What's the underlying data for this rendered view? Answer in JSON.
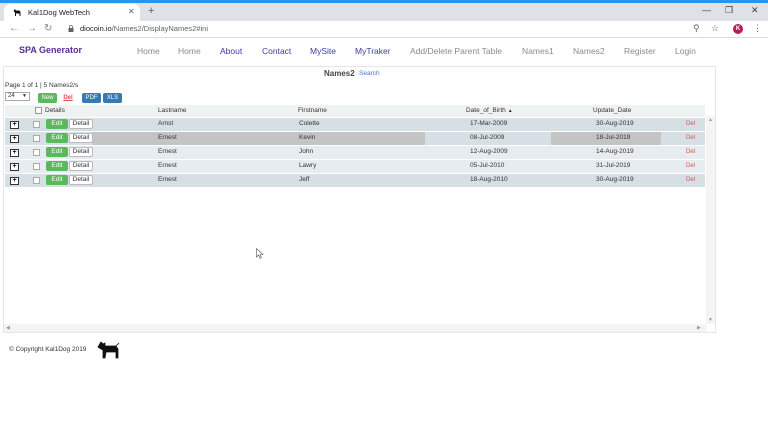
{
  "browser": {
    "tab_title": "Kal1Dog WebTech",
    "tab_close": "✕",
    "new_tab": "+",
    "url_host": "diocoin.io",
    "url_path": "/Names2/DisplayNames2#ini",
    "profile_initial": "K",
    "icons": [
      "back-icon",
      "forward-icon",
      "reload-icon",
      "lock-icon",
      "zoom-icon",
      "star-icon",
      "menu-icon"
    ]
  },
  "nav": {
    "brand": "SPA Generator",
    "links": [
      "Home",
      "Home",
      "About",
      "Contact",
      "MySite",
      "MyTraker",
      "Add/Delete Parent Table",
      "Names1",
      "Names2",
      "Register",
      "Login"
    ],
    "link_colors": {
      "grey": "#8a8a8a",
      "blue": "#3d3d9c"
    }
  },
  "grid": {
    "title": "Names2",
    "search_label": "Search",
    "page_info": "Page 1 of 1  |  5 Names2/s",
    "page_size": "24",
    "toolbar": {
      "new": "New",
      "del": "Del",
      "pdf": "PDF",
      "xls": "XLS"
    },
    "columns": [
      "Details",
      "Lastname",
      "Firstname",
      "Date_of_Birth",
      "Update_Date"
    ],
    "sort_column": "Date_of_Birth",
    "sort_indicator": "▲",
    "row_buttons": {
      "expand": "+",
      "edit": "Edit",
      "detail": "Detail",
      "delete": "Del"
    },
    "rows": [
      {
        "lastname": "Arnst",
        "firstname": "Colette",
        "dob": "17-Mar-2009",
        "updated": "30-Aug-2019"
      },
      {
        "lastname": "Ernest",
        "firstname": "Kevin",
        "dob": "08-Jul-2009",
        "updated": "18-Jul-2019"
      },
      {
        "lastname": "Ernest",
        "firstname": "John",
        "dob": "12-Aug-2009",
        "updated": "14-Aug-2019"
      },
      {
        "lastname": "Ernest",
        "firstname": "Lawry",
        "dob": "05-Jul-2010",
        "updated": "31-Jul-2019"
      },
      {
        "lastname": "Ernest",
        "firstname": "Jeff",
        "dob": "18-Aug-2010",
        "updated": "30-Aug-2019"
      }
    ],
    "selected_row": 1
  },
  "footer": {
    "copyright": "© Copyright Kal1Dog 2019"
  },
  "colors": {
    "brand": "#5b2c91",
    "edit_button": "#5cb85c",
    "export_button": "#337ab7",
    "delete_text": "#d9534f",
    "accent": "#2196f3"
  }
}
